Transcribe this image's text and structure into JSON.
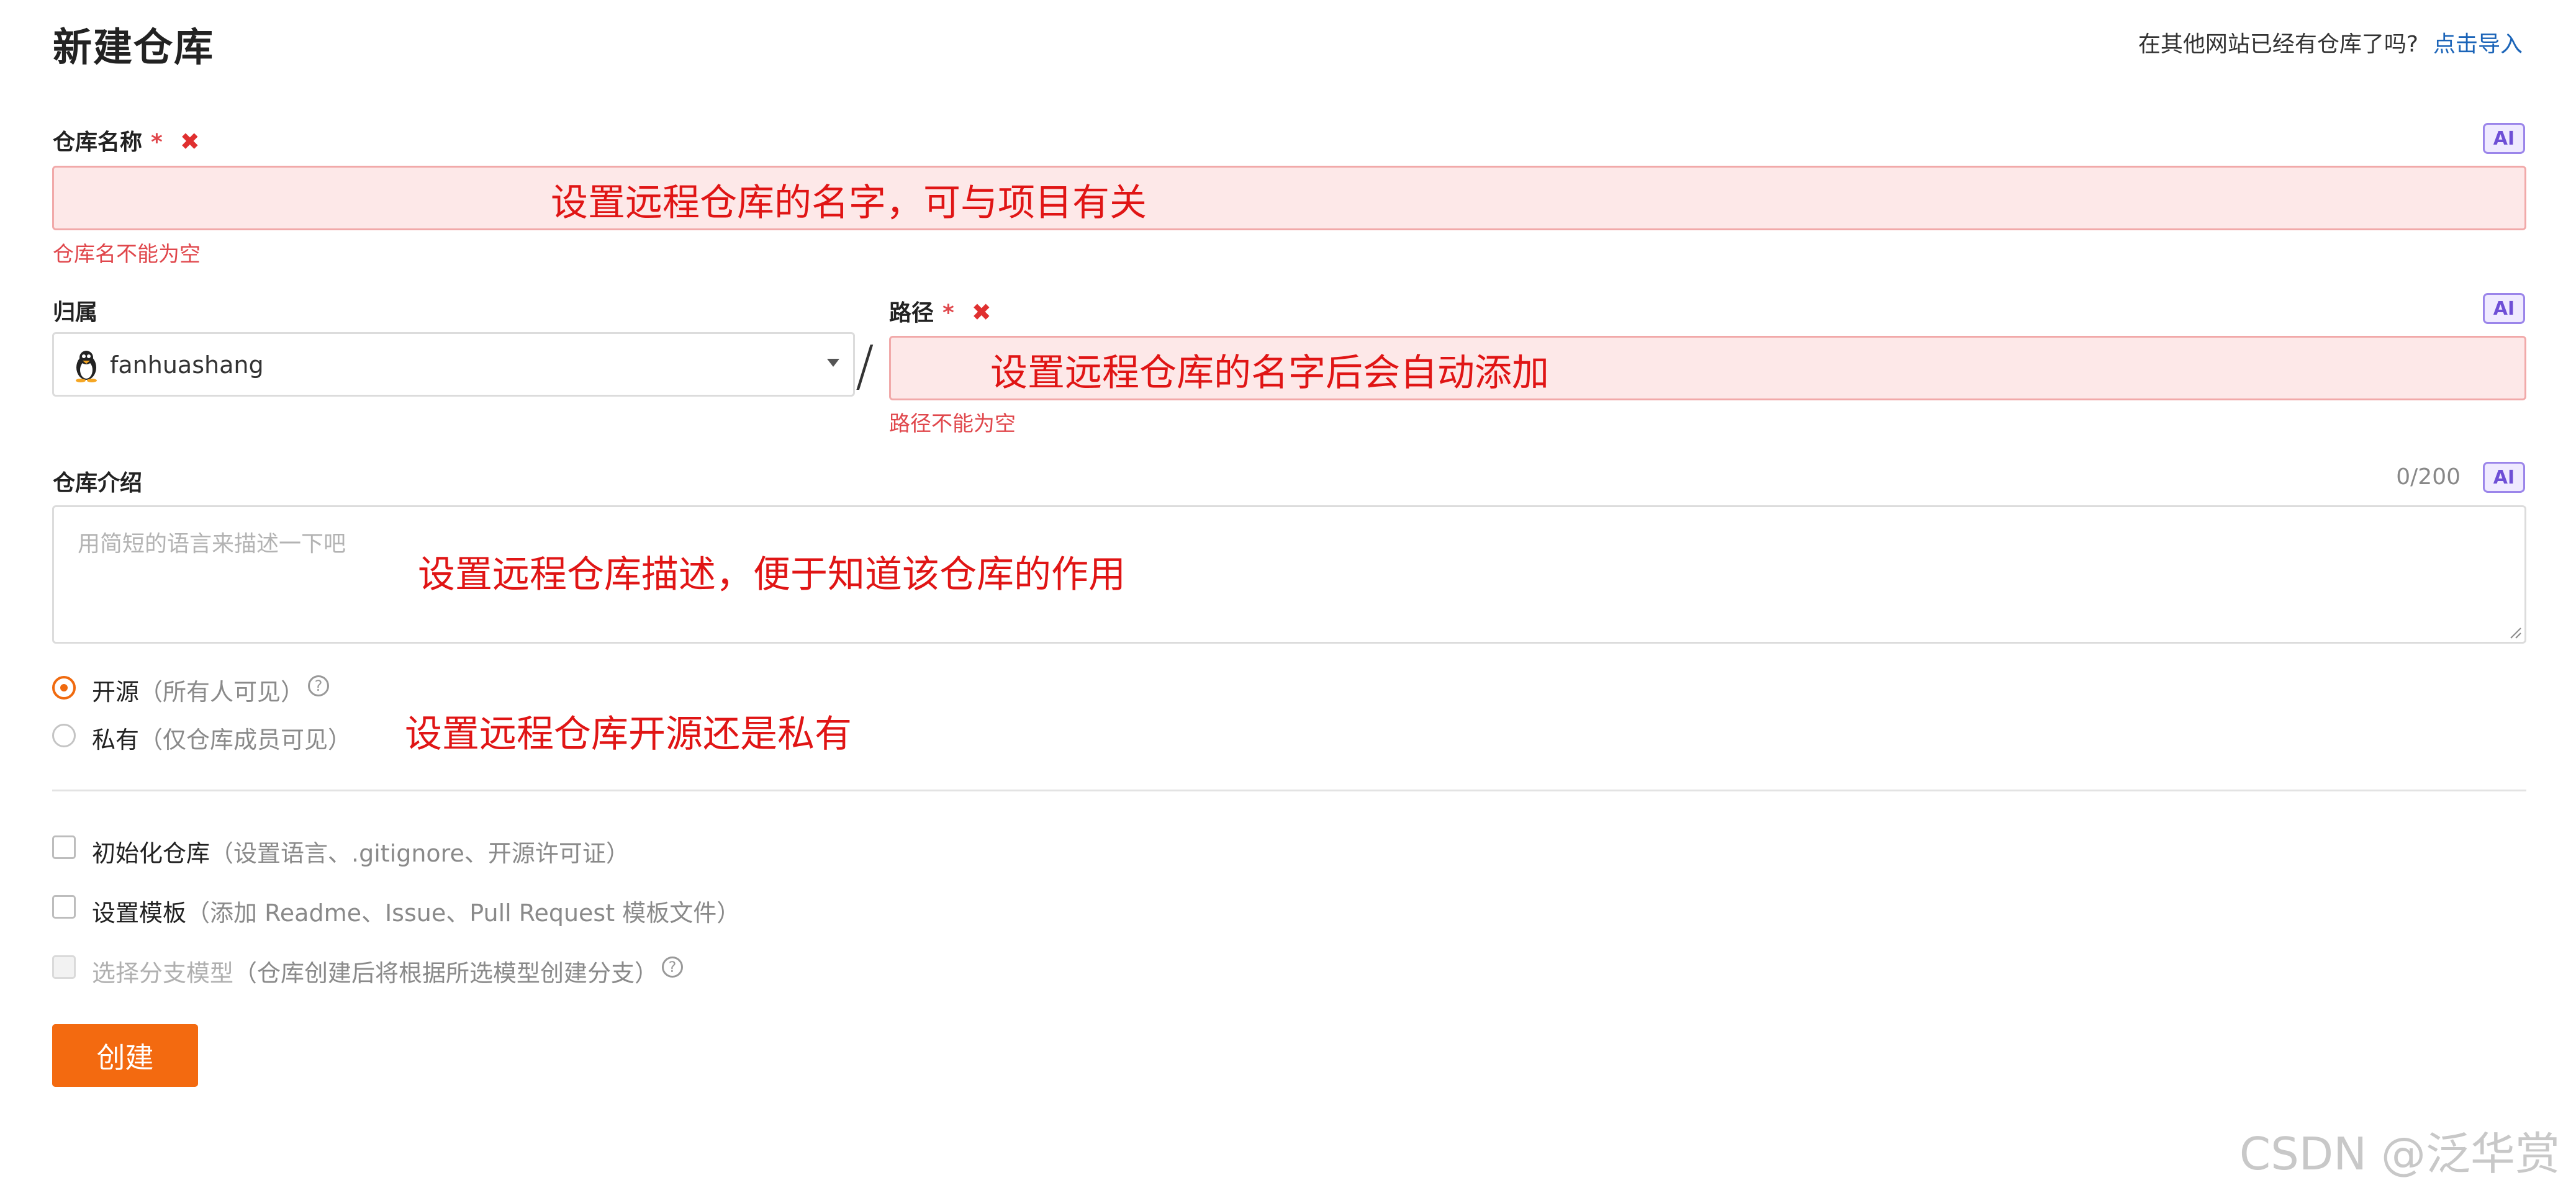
{
  "header": {
    "title": "新建仓库",
    "import_prompt": "在其他网站已经有仓库了吗?",
    "import_link": "点击导入"
  },
  "repo_name": {
    "label": "仓库名称",
    "required_mark": "*",
    "error_icon": "close-x-icon",
    "ai_badge": "AI",
    "annotation": "设置远程仓库的名字，可与项目有关",
    "error": "仓库名不能为空"
  },
  "owner": {
    "label": "归属",
    "value": "fanhuashang",
    "avatar_icon": "penguin-avatar-icon",
    "separator": "/"
  },
  "path": {
    "label": "路径",
    "required_mark": "*",
    "error_icon": "close-x-icon",
    "ai_badge": "AI",
    "annotation": "设置远程仓库的名字后会自动添加",
    "error": "路径不能为空"
  },
  "description": {
    "label": "仓库介绍",
    "counter": "0/200",
    "ai_badge": "AI",
    "placeholder": "用简短的语言来描述一下吧",
    "annotation": "设置远程仓库描述，便于知道该仓库的作用"
  },
  "visibility": {
    "options": [
      {
        "label": "开源",
        "hint": "（所有人可见）",
        "checked": true
      },
      {
        "label": "私有",
        "hint": "（仅仓库成员可见）",
        "checked": false
      }
    ],
    "annotation": "设置远程仓库开源还是私有",
    "help_icon": "question-circle-icon",
    "help_glyph": "?"
  },
  "options": [
    {
      "label": "初始化仓库",
      "hint": "（设置语言、.gitignore、开源许可证）",
      "checked": false,
      "disabled": false
    },
    {
      "label": "设置模板",
      "hint": "（添加 Readme、Issue、Pull Request 模板文件）",
      "checked": false,
      "disabled": false
    },
    {
      "label": "选择分支模型",
      "hint": "（仓库创建后将根据所选模型创建分支）",
      "checked": false,
      "disabled": true
    }
  ],
  "submit": {
    "label": "创建"
  },
  "watermark": "CSDN @泛华赏",
  "colors": {
    "accent": "#f36a10",
    "error": "#e0474c",
    "annotation": "#e01515",
    "link": "#1b64b8",
    "ai_badge": "#6e4fd6"
  }
}
